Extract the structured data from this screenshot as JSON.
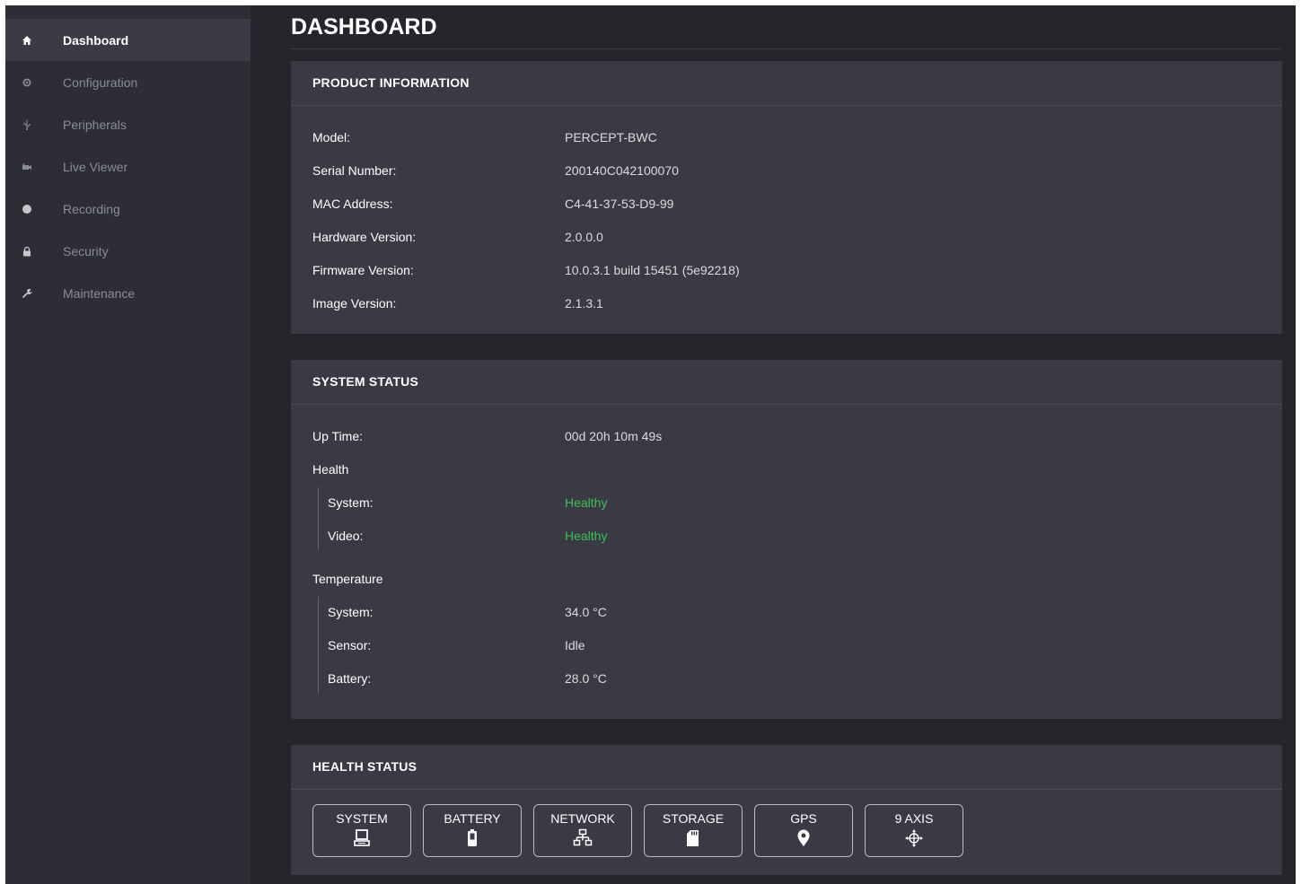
{
  "sidebar": {
    "items": [
      {
        "label": "Dashboard",
        "icon": "home-icon",
        "active": true
      },
      {
        "label": "Configuration",
        "icon": "gear-icon",
        "active": false
      },
      {
        "label": "Peripherals",
        "icon": "usb-icon",
        "active": false
      },
      {
        "label": "Live Viewer",
        "icon": "camera-icon",
        "active": false
      },
      {
        "label": "Recording",
        "icon": "record-dot-icon",
        "active": false
      },
      {
        "label": "Security",
        "icon": "lock-icon",
        "active": false
      },
      {
        "label": "Maintenance",
        "icon": "wrench-icon",
        "active": false
      }
    ]
  },
  "page": {
    "title": "DASHBOARD"
  },
  "product_info": {
    "title": "PRODUCT INFORMATION",
    "rows": [
      {
        "label": "Model:",
        "value": "PERCEPT-BWC"
      },
      {
        "label": "Serial Number:",
        "value": "200140C042100070"
      },
      {
        "label": "MAC Address:",
        "value": "C4-41-37-53-D9-99"
      },
      {
        "label": "Hardware Version:",
        "value": "2.0.0.0"
      },
      {
        "label": "Firmware Version:",
        "value": "10.0.3.1 build 15451 (5e92218)"
      },
      {
        "label": "Image Version:",
        "value": "2.1.3.1"
      }
    ]
  },
  "system_status": {
    "title": "SYSTEM STATUS",
    "uptime": {
      "label": "Up Time:",
      "value": "00d 20h 10m 49s"
    },
    "health": {
      "label": "Health",
      "rows": [
        {
          "label": "System:",
          "value": "Healthy"
        },
        {
          "label": "Video:",
          "value": "Healthy"
        }
      ]
    },
    "temperature": {
      "label": "Temperature",
      "rows": [
        {
          "label": "System:",
          "value": "34.0 °C"
        },
        {
          "label": "Sensor:",
          "value": "Idle"
        },
        {
          "label": "Battery:",
          "value": "28.0 °C"
        }
      ]
    }
  },
  "health_status": {
    "title": "HEALTH STATUS",
    "buttons": [
      {
        "label": "SYSTEM",
        "icon": "computer-icon"
      },
      {
        "label": "BATTERY",
        "icon": "battery-icon"
      },
      {
        "label": "NETWORK",
        "icon": "network-icon"
      },
      {
        "label": "STORAGE",
        "icon": "sd-card-icon"
      },
      {
        "label": "GPS",
        "icon": "map-pin-icon"
      },
      {
        "label": "9 AXIS",
        "icon": "axis-icon"
      }
    ]
  },
  "colors": {
    "background": "#25262b",
    "sidebar": "#2d2e35",
    "card": "#393a43",
    "healthy": "#3fbf5a"
  }
}
